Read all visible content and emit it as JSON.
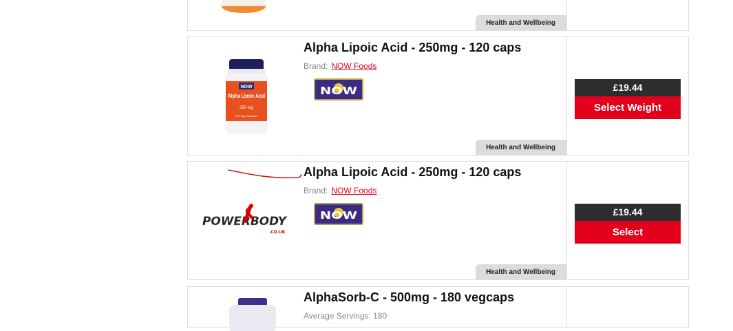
{
  "products": [
    {
      "category": "Health and Wellbeing"
    },
    {
      "title": "Alpha Lipoic Acid - 250mg - 120 caps",
      "brand_label": "Brand:",
      "brand_name": "NOW Foods",
      "brand_logo_text": "NOW",
      "image": {
        "lid": "NOW",
        "name": "Alpha Lipoic Acid",
        "dose": "250 mg",
        "count": "120 Veg Capsules"
      },
      "category": "Health and Wellbeing",
      "price": "£19.44",
      "button": "Select Weight"
    },
    {
      "title": "Alpha Lipoic Acid - 250mg - 120 caps",
      "brand_label": "Brand:",
      "brand_name": "NOW Foods",
      "brand_logo_text": "NOW",
      "image_logo": "POWERBODY",
      "image_logo_sub": ".CO.UK",
      "category": "Health and Wellbeing",
      "price": "£19.44",
      "button": "Select"
    },
    {
      "title": "AlphaSorb-C - 500mg - 180 vegcaps",
      "avg_servings": "Average Servings: 180"
    }
  ],
  "colors": {
    "accent_red": "#e3001b",
    "price_bg": "#2d2d2d",
    "brand_purple": "#3a2b86"
  }
}
